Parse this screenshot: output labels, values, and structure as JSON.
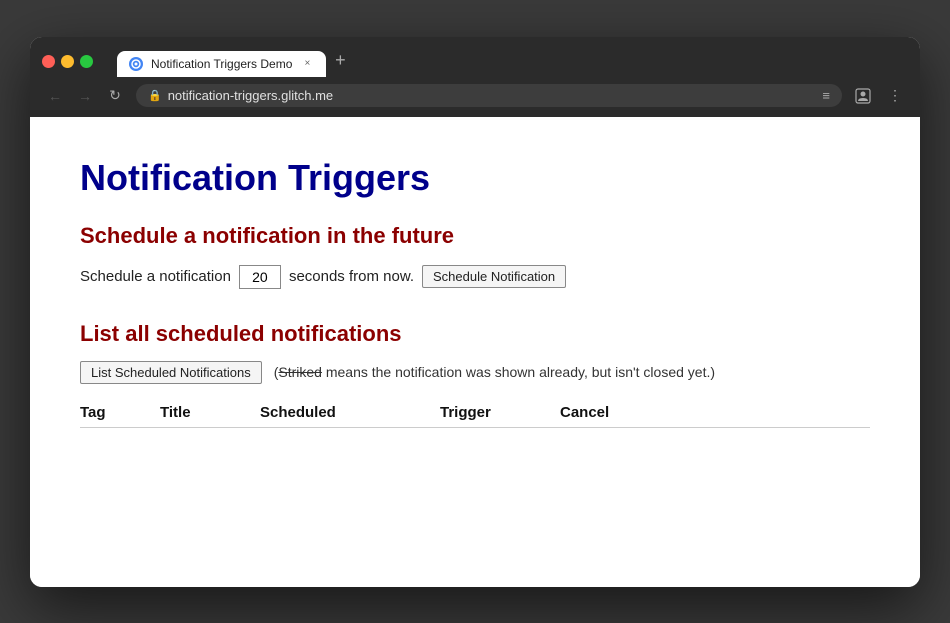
{
  "browser": {
    "tab_title": "Notification Triggers Demo",
    "url": "notification-triggers.glitch.me",
    "new_tab_label": "+",
    "tab_close_label": "×"
  },
  "nav": {
    "back_icon": "←",
    "forward_icon": "→",
    "reload_icon": "↻",
    "lock_icon": "🔒",
    "list_icon": "≡",
    "profile_icon": "👤",
    "more_icon": "⋮"
  },
  "page": {
    "main_title": "Notification Triggers",
    "section1_title": "Schedule a notification in the future",
    "schedule_label_before": "Schedule a notification",
    "schedule_input_value": "20",
    "schedule_label_after": "seconds from now.",
    "schedule_button_label": "Schedule Notification",
    "section2_title": "List all scheduled notifications",
    "list_button_label": "List Scheduled Notifications",
    "list_info_prefix": "(",
    "list_info_striked": "Striked",
    "list_info_suffix": " means the notification was shown already, but isn't closed yet.)",
    "table_headers": [
      "Tag",
      "Title",
      "Scheduled",
      "Trigger",
      "Cancel"
    ]
  }
}
